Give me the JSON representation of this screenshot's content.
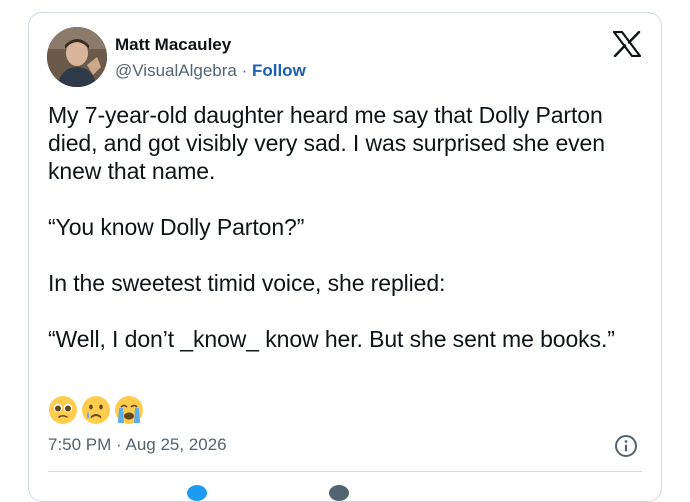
{
  "author": {
    "name": "Matt Macauley",
    "handle": "@VisualAlgebra",
    "separator": " · ",
    "follow_label": "Follow"
  },
  "platform_icon": "x-logo-icon",
  "post": {
    "paragraphs": [
      "My 7-year-old daughter heard me say that Dolly Parton died, and got visibly very sad. I was surprised she even knew that name.",
      "“You know Dolly Parton?”",
      "In the sweetest timid voice, she replied:",
      "“Well, I don’t _know_ know her. But she sent me books.”"
    ],
    "emojis": [
      "pleading-face-icon",
      "crying-face-icon",
      "loudly-crying-face-icon"
    ]
  },
  "timestamp": "7:50 PM · Aug 25, 2026",
  "info_icon": "info-icon",
  "colors": {
    "text": "#0f1419",
    "secondary_text": "#536471",
    "follow": "#1d5fb0",
    "border": "#cfd9de"
  }
}
